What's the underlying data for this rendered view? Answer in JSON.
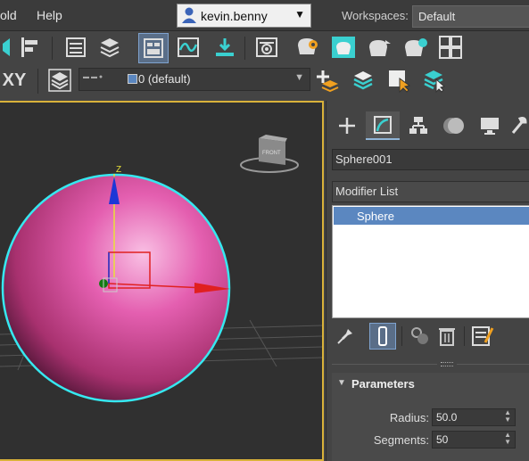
{
  "menubar": {
    "items": [
      "old",
      "Help"
    ]
  },
  "user": {
    "name": "kevin.benny"
  },
  "workspaces": {
    "label": "Workspaces:",
    "value": "Default"
  },
  "layer": {
    "current": "0 (default)"
  },
  "viewport": {
    "nav_cube_label": "FRONT",
    "gizmo_axis_label": "Z"
  },
  "command_panel": {
    "tabs": [
      "create",
      "modify",
      "hierarchy",
      "motion",
      "display",
      "utilities"
    ],
    "object_name": "Sphere001",
    "modifier_list_label": "Modifier List",
    "stack_items": [
      "Sphere"
    ],
    "rollout": {
      "title": "Parameters",
      "radius_label": "Radius:",
      "radius_value": "50.0",
      "segments_label": "Segments:",
      "segments_value": "50"
    }
  },
  "colors": {
    "accent": "#5b87c0",
    "viewport_border": "#d9b23a",
    "sphere": "#d9559f",
    "selection": "#36e8f0"
  }
}
